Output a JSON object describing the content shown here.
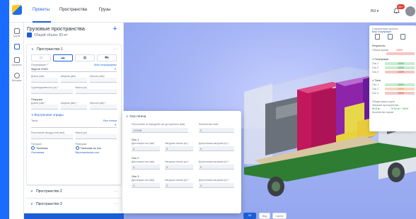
{
  "topbar": {
    "tabs": [
      {
        "label": "Проекты"
      },
      {
        "label": "Пространства"
      },
      {
        "label": "Грузы"
      }
    ],
    "language": "RU",
    "notifications_count": "99+"
  },
  "rail": {
    "items": [
      {
        "label": "Грузы",
        "icon": "cargo-icon"
      },
      {
        "label": "",
        "icon": "truck-icon"
      },
      {
        "label": "Проекты",
        "icon": "projects-icon"
      },
      {
        "label": "История",
        "icon": "history-icon"
      }
    ]
  },
  "panel": {
    "title": "Грузовые пространства",
    "add_label": "+",
    "total_volume": "Общий объем: 83 м³",
    "space1": {
      "title": "Пространство 1",
      "type_tabs": [
        "▭",
        "▬",
        "▦",
        "⛟"
      ],
      "preset_label": "Полуприцеп *",
      "preset_link": "Мои полуприцепы",
      "preset_value": "Фургон 20DC",
      "dims": [
        "Длина (мм)",
        "Ширина (мм)",
        "Высота (мм)"
      ],
      "capacity": [
        "Грузоподъемность (кг) *",
        "Масса (кг)"
      ],
      "door_title": "Погрузка",
      "door_dims": [
        "Длина (мм) *",
        "Ширина (мм) *",
        "Высота (мм) *"
      ],
      "inner_title": "Внутренние ограды",
      "axes_label": "Тягач",
      "axes_link": "Все тягачи",
      "load_fields": [
        "Расстояние между осей (мм)",
        "Масса (кг)"
      ],
      "loading_label": "Погрузка",
      "loading_opts": [
        "Тягачная",
        "Основная"
      ],
      "unload_label": "Разгрузка",
      "unload_opts": [
        "Тягачная на ось",
        "Вертикальная ось"
      ]
    },
    "space2": {
      "title": "Пространство 2"
    },
    "space3": {
      "title": "Пространство 3"
    }
  },
  "popup": {
    "title": "Оси тягача",
    "field1_label": "Расстояние от передней оси до сцепного (мм)",
    "field1_value": "125/08",
    "field2_label": "Количество осей",
    "field2_value": "3",
    "axes": [
      {
        "title": "Ось 1",
        "labels": [
          "Дистанция оси (мм)",
          "Нагрузка тягача (кг) *",
          "Допустимая нагрузка (кг) *"
        ],
        "values": [
          "0",
          "0",
          "0"
        ]
      },
      {
        "title": "Ось 2",
        "labels": [
          "Дистанция оси (мм)",
          "Нагрузка тягача (кг) *",
          "Допустимая нагрузка (кг) *"
        ],
        "values": [
          "0",
          "0",
          "0"
        ]
      },
      {
        "title": "Ось 3",
        "labels": [
          "Дистанция оси (мм)",
          "Нагрузка тягача (кг) *",
          "Допустимая нагрузка (кг) *"
        ],
        "values": [
          "0",
          "0",
          "0"
        ]
      }
    ]
  },
  "stats": {
    "head1": "Сохраненные проекты",
    "head1_link": "Ваш полуприцеп",
    "results_title": "Результаты",
    "volume_label": "Объем кузова",
    "volume_value": "100%",
    "semitrailer_title": "Полуприцеп",
    "axles": [
      {
        "label": "Ось 1",
        "value": "100%"
      },
      {
        "label": "Ось 2",
        "value": "100%"
      },
      {
        "label": "Ось 3",
        "value": "100%"
      }
    ],
    "tractor_title": "Тягач",
    "taxles": [
      {
        "label": "Ось 1",
        "value": "100%"
      },
      {
        "label": "Ось 2",
        "value": "100%"
      },
      {
        "label": "Ось 3",
        "value": "100%"
      }
    ],
    "summary1": "Общая масса груза",
    "summary2": "Загрузка пространства",
    "summary_green": "83.8 м³",
    "summary_value": "75.94 м³ / 100%",
    "summary3": "Количество грузов"
  },
  "toolbar": {
    "view_label": "3D",
    "btn2": "Вид",
    "btn3": "Сцены"
  }
}
